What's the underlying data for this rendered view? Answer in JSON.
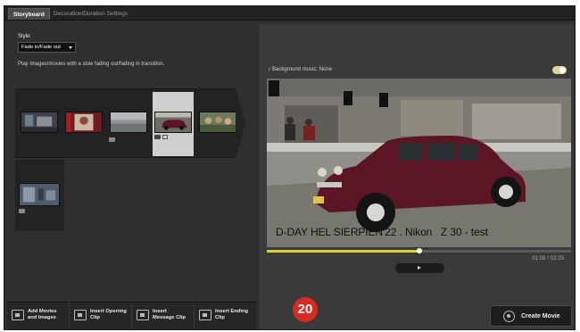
{
  "tabs": [
    {
      "label": "Storyboard",
      "active": true
    },
    {
      "label": "Decoration/Duration Settings",
      "active": false
    }
  ],
  "style": {
    "label": "Style:",
    "selected": "Fade in/Fade out",
    "hint": "Play images/movies with a slow fading out/fading in transition."
  },
  "storyboard": {
    "clips": [
      {
        "thumb": "stage-photo"
      },
      {
        "thumb": "red-portrait"
      },
      {
        "thumb": "grey-landscape"
      },
      {
        "thumb": "vintage-car",
        "selected": true
      },
      {
        "thumb": "crowd-photo"
      }
    ],
    "second_row_clips": [
      {
        "thumb": "blue-outdoor"
      }
    ]
  },
  "bottom_buttons": [
    {
      "icon": "add-media-icon",
      "line1": "Add Movies",
      "line2": "and Images"
    },
    {
      "icon": "opening-clip-icon",
      "line1": "Insert Opening",
      "line2": "Clip"
    },
    {
      "icon": "message-clip-icon",
      "line1": "Insert",
      "line2": "Message Clip"
    },
    {
      "icon": "ending-clip-icon",
      "line1": "Insert Ending",
      "line2": "Clip"
    }
  ],
  "preview": {
    "music_label": "Background music: None",
    "music_toggle_on": true,
    "caption": "D-DAY HEL SIERPIEN'22 . Nikon   Z 30 - test",
    "progress": 0.5,
    "time_current": "01:08",
    "time_sep": "/",
    "time_total": "02:25"
  },
  "create_movie_label": "Create Movie",
  "step_badge": "20",
  "colors": {
    "accent_progress": "#d9cf38",
    "badge": "#d82a20",
    "panel_dark": "#232323",
    "panel": "#2f2f2f"
  }
}
